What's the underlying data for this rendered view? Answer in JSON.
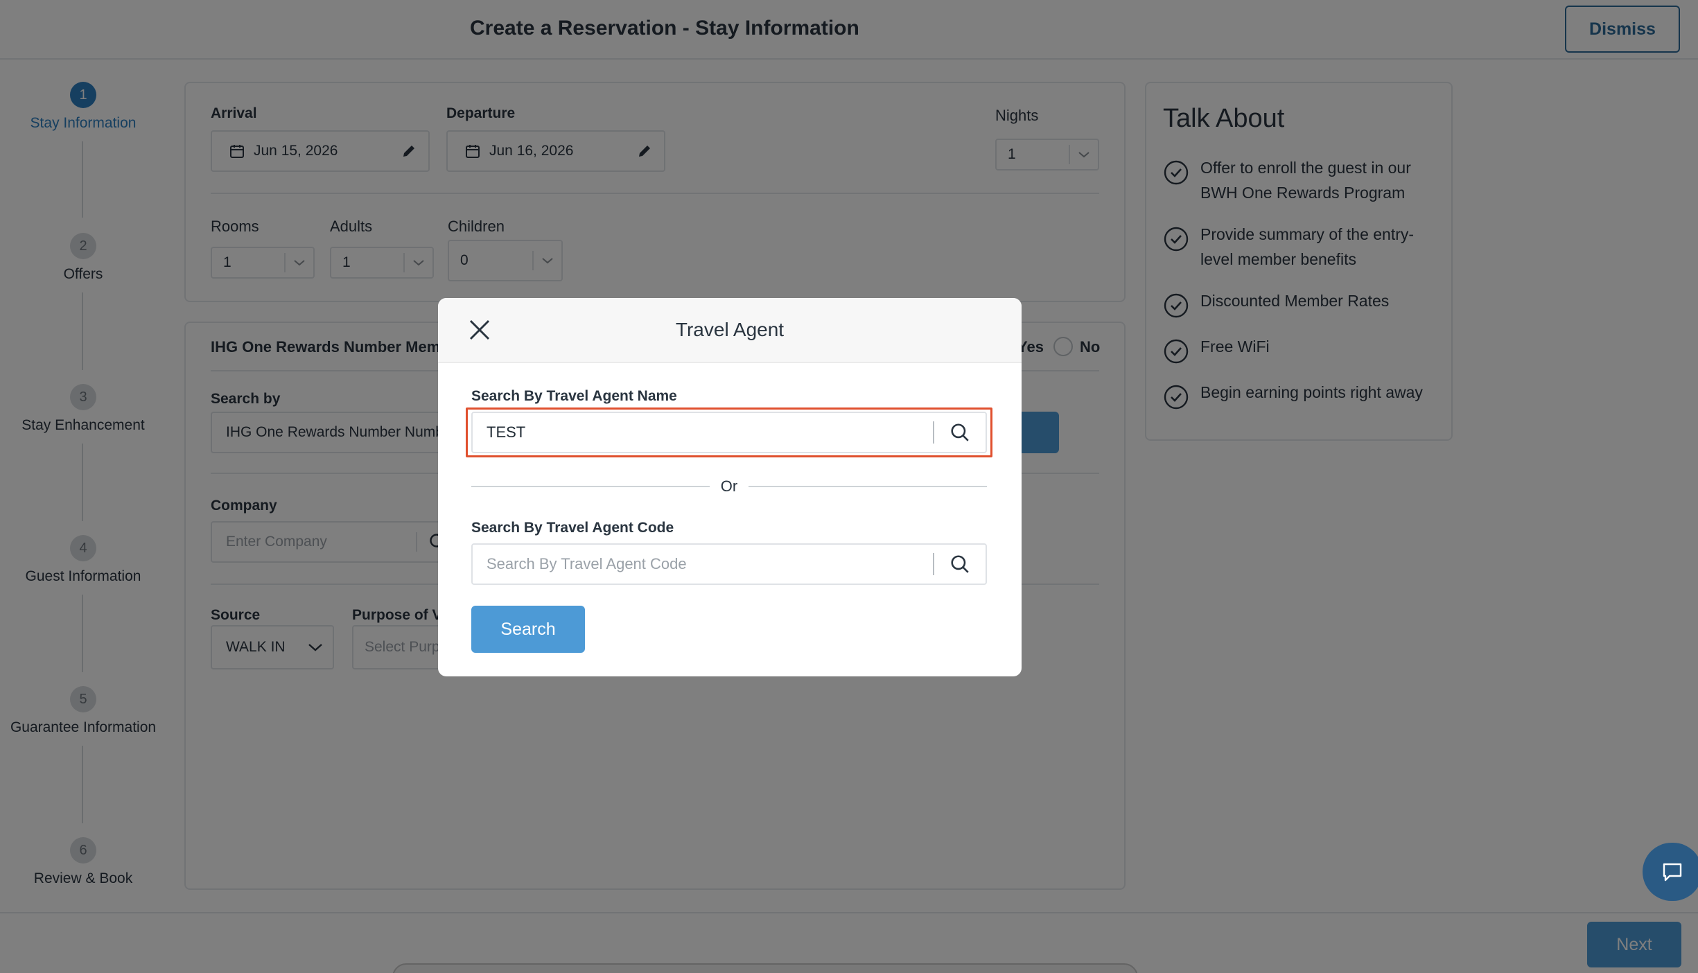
{
  "header": {
    "title": "Create a Reservation - Stay Information",
    "dismiss_label": "Dismiss"
  },
  "stepper": {
    "steps": [
      {
        "number": "1",
        "label": "Stay Information"
      },
      {
        "number": "2",
        "label": "Offers"
      },
      {
        "number": "3",
        "label": "Stay Enhancement"
      },
      {
        "number": "4",
        "label": "Guest Information"
      },
      {
        "number": "5",
        "label": "Guarantee Information"
      },
      {
        "number": "6",
        "label": "Review & Book"
      }
    ]
  },
  "stay": {
    "arrival_label": "Arrival",
    "arrival_value": "Jun 15, 2026",
    "departure_label": "Departure",
    "departure_value": "Jun 16, 2026",
    "nights_label": "Nights",
    "nights_value": "1",
    "rooms_label": "Rooms",
    "rooms_value": "1",
    "adults_label": "Adults",
    "adults_value": "1",
    "children_label": "Children",
    "children_value": "0"
  },
  "member": {
    "question_label": "IHG One Rewards Number Memb",
    "yes_label": "Yes",
    "no_label": "No",
    "search_by_label": "Search by",
    "search_by_value": "IHG One Rewards Number Numb",
    "company_label": "Company",
    "company_placeholder": "Enter Company",
    "source_label": "Source",
    "source_value": "WALK IN",
    "purpose_label": "Purpose of Vi",
    "purpose_placeholder": "Select Purp"
  },
  "talk_about": {
    "title": "Talk About",
    "items": [
      "Offer to enroll the guest in our BWH One Rewards Program",
      "Provide summary of the entry-level member benefits",
      "Discounted Member Rates",
      "Free WiFi",
      "Begin earning points right away"
    ]
  },
  "modal": {
    "title": "Travel Agent",
    "name_label": "Search By Travel Agent Name",
    "name_value": "TEST",
    "or_label": "Or",
    "code_label": "Search By Travel Agent Code",
    "code_placeholder": "Search By Travel Agent Code",
    "search_label": "Search"
  },
  "footer": {
    "next_label": "Next"
  },
  "colors": {
    "accent": "#2d7fc1",
    "button": "#4d9ad6",
    "highlight": "#e0502e",
    "overlay": "rgba(0,0,0,0.5)"
  },
  "icons": [
    "calendar-icon",
    "pencil-icon",
    "chevron-down-icon",
    "search-icon",
    "check-circle-icon",
    "close-icon",
    "chat-icon"
  ]
}
